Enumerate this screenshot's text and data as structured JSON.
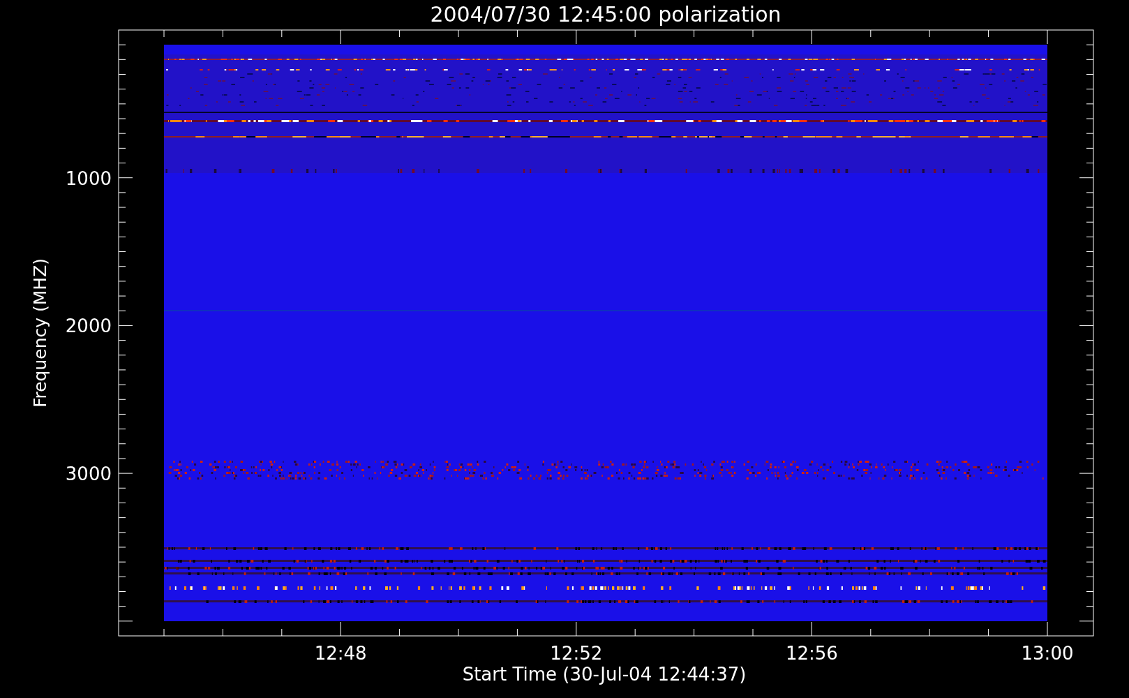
{
  "title": "2004/07/30 12:45:00 polarization",
  "y_axis": {
    "label": "Frequency (MHZ)",
    "tick_labels": [
      "1000",
      "2000",
      "3000"
    ]
  },
  "x_axis": {
    "label": "Start Time (30-Jul-04 12:44:37)",
    "tick_labels": [
      "12:48",
      "12:52",
      "12:56",
      "13:00"
    ]
  }
}
